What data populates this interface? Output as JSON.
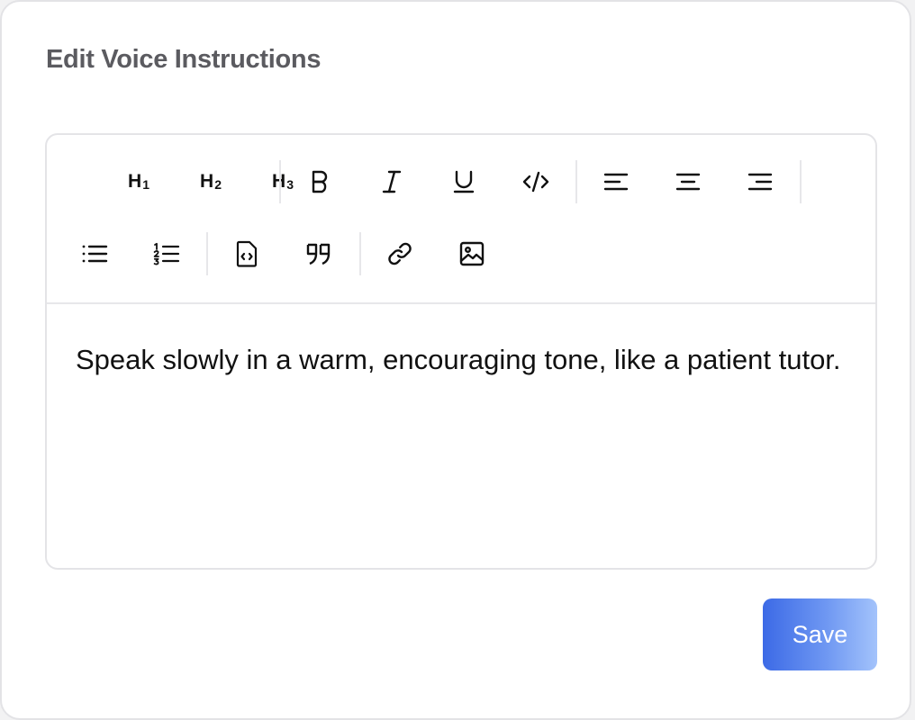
{
  "dialog": {
    "title": "Edit Voice Instructions"
  },
  "toolbar": {
    "heading1": {
      "letter": "H",
      "level": "1"
    },
    "heading2": {
      "letter": "H",
      "level": "2"
    },
    "heading3": {
      "letter": "H",
      "level": "3"
    },
    "icons": [
      "bold-icon",
      "italic-icon",
      "underline-icon",
      "code-icon",
      "align-left-icon",
      "align-center-icon",
      "align-right-icon",
      "bullet-list-icon",
      "ordered-list-icon",
      "code-block-icon",
      "blockquote-icon",
      "link-icon",
      "image-icon"
    ]
  },
  "editor": {
    "content": "Speak slowly in a warm, encouraging tone, like a patient tutor."
  },
  "actions": {
    "save_label": "Save"
  },
  "colors": {
    "accent_start": "#3c6ae6",
    "accent_end": "#a3c3fb",
    "title": "#5b5b60",
    "text": "#111111"
  }
}
